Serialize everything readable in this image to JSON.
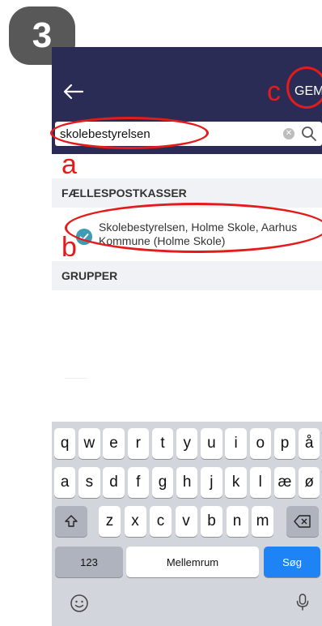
{
  "step_badge": "3",
  "header": {
    "back_icon": "arrow-left-icon",
    "save_label": "GEM"
  },
  "search": {
    "value": "skolebestyrelsen",
    "clear_icon": "clear-icon",
    "search_icon": "search-icon"
  },
  "sections": [
    {
      "title": "FÆLLESPOSTKASSER"
    },
    {
      "title": "GRUPPER"
    }
  ],
  "result": {
    "label": "Skolebestyrelsen, Holme Skole, Aarhus Kommune (Holme Skole)",
    "selected": true
  },
  "keyboard": {
    "row1": [
      "q",
      "w",
      "e",
      "r",
      "t",
      "y",
      "u",
      "i",
      "o",
      "p",
      "å"
    ],
    "row2": [
      "a",
      "s",
      "d",
      "f",
      "g",
      "h",
      "j",
      "k",
      "l",
      "æ",
      "ø"
    ],
    "row3": [
      "z",
      "x",
      "c",
      "v",
      "b",
      "n",
      "m"
    ],
    "shift_icon": "shift-icon",
    "backspace_icon": "backspace-icon",
    "numbers_label": "123",
    "space_label": "Mellemrum",
    "search_key_label": "Søg",
    "emoji_icon": "emoji-icon",
    "mic_icon": "microphone-icon"
  },
  "annotations": {
    "a": "a",
    "b": "b",
    "c": "c"
  },
  "colors": {
    "header_bg": "#2b2c55",
    "check": "#3e9bb3",
    "annotation": "#e31b1b",
    "search_key": "#1e84f6"
  }
}
